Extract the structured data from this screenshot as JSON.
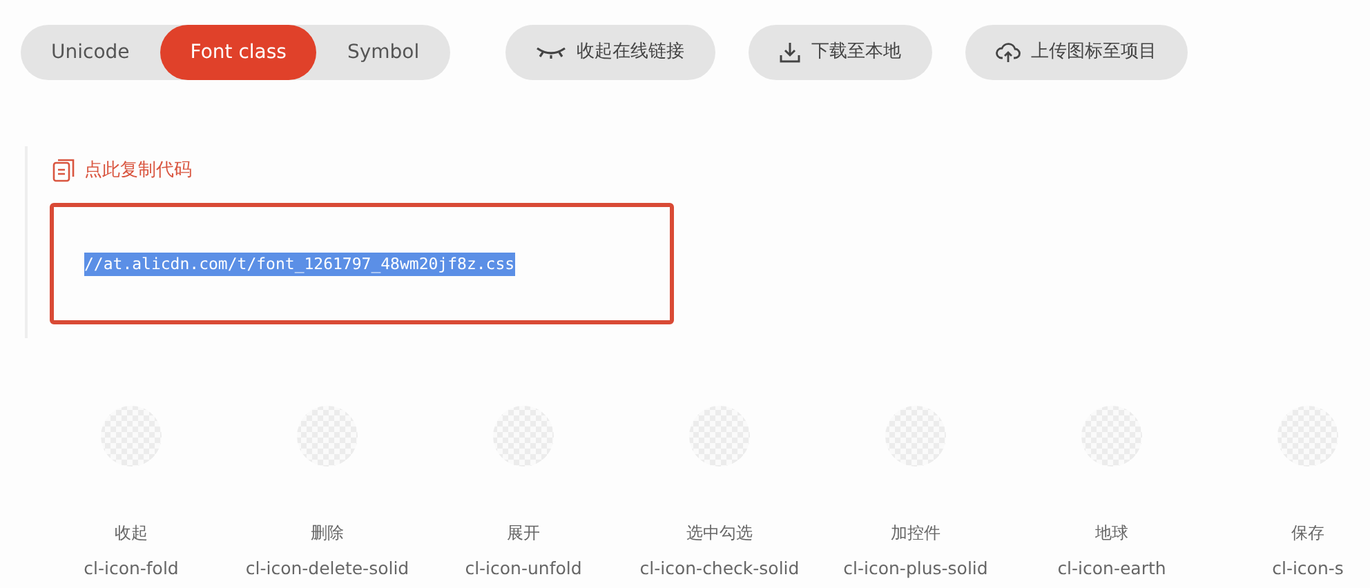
{
  "tabs": [
    {
      "label": "Unicode",
      "selected": false
    },
    {
      "label": "Font class",
      "selected": true
    },
    {
      "label": "Symbol",
      "selected": false
    }
  ],
  "actions": [
    {
      "kind": "eye",
      "label": "收起在线链接"
    },
    {
      "kind": "download",
      "label": "下载至本地"
    },
    {
      "kind": "upload",
      "label": "上传图标至项目"
    }
  ],
  "copy_link": {
    "label": "点此复制代码"
  },
  "code": {
    "text": "//at.alicdn.com/t/font_1261797_48wm20jf8z.css",
    "selected": true
  },
  "icons": [
    {
      "title": "收起",
      "class_name": "cl-icon-fold"
    },
    {
      "title": "删除",
      "class_name": "cl-icon-delete-solid"
    },
    {
      "title": "展开",
      "class_name": "cl-icon-unfold"
    },
    {
      "title": "选中勾选",
      "class_name": "cl-icon-check-solid"
    },
    {
      "title": "加控件",
      "class_name": "cl-icon-plus-solid"
    },
    {
      "title": "地球",
      "class_name": "cl-icon-earth"
    },
    {
      "title": "保存",
      "class_name": "cl-icon-s"
    }
  ]
}
